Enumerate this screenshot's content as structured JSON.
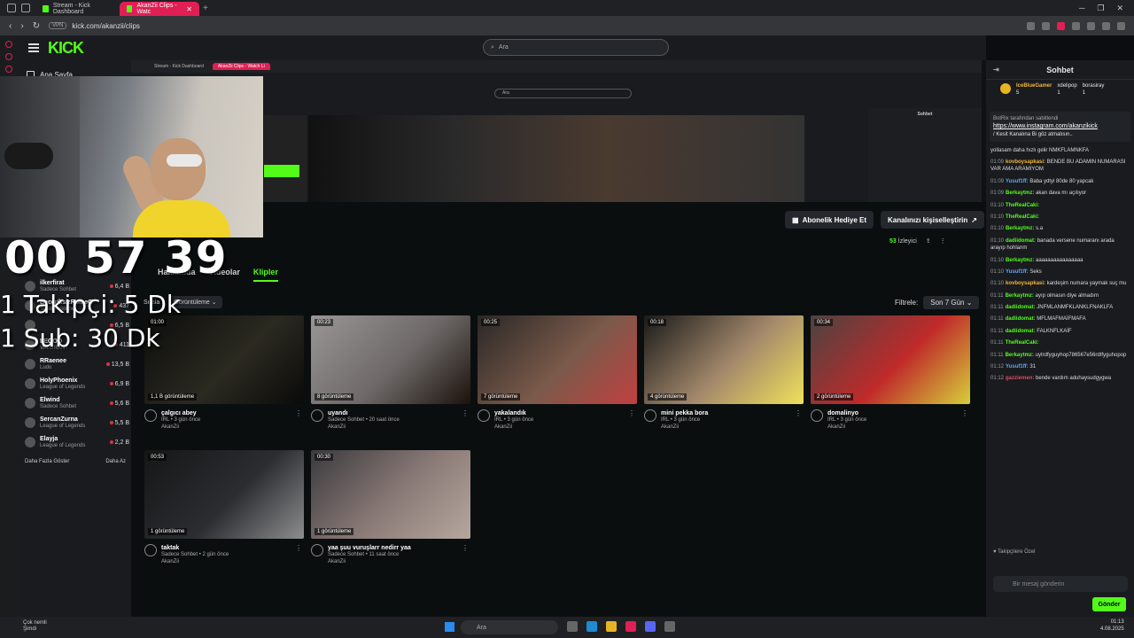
{
  "browser": {
    "tabs": [
      {
        "label": "Stream - Kick Dashboard"
      },
      {
        "label": "AkanZii Clips - Watc"
      }
    ],
    "url": "kick.com/akanzii/clips",
    "vpn_label": "VPN"
  },
  "header": {
    "logo": "KICK",
    "search_placeholder": "Ara"
  },
  "left_nav": {
    "home_label": "Ana Sayfa",
    "streamers": [
      {
        "name": "ilkerfirat",
        "category": "Sadece Sohbet",
        "count": "6,4 B"
      },
      {
        "name": "BeceriksizRomeO",
        "category": "Sadece Sohbet",
        "count": "437"
      },
      {
        "name": "",
        "category": "",
        "count": "6,5 B"
      },
      {
        "name": "LEGOO",
        "category": "VALORANT",
        "count": "411"
      },
      {
        "name": "RRaenee",
        "category": "Ludo",
        "count": "13,5 B"
      },
      {
        "name": "HolyPhoenix",
        "category": "League of Legends",
        "count": "6,9 B"
      },
      {
        "name": "Elwind",
        "category": "Sadece Sohbet",
        "count": "5,6 B"
      },
      {
        "name": "SercanZurna",
        "category": "League of Legends",
        "count": "5,5 B"
      },
      {
        "name": "Elayja",
        "category": "League of Legends",
        "count": "2,2 B"
      }
    ],
    "show_more": "Daha Fazla Göster",
    "show_less": "Daha Az"
  },
  "overlay": {
    "timer": "00 57 39",
    "goal_follow": "1 Takipçi: 5 Dk",
    "goal_sub": "1 Sub: 30 Dk"
  },
  "nested": {
    "tab1": "Stream - Kick Dashboard",
    "tab2": "AkanZii Clips - Watch Li",
    "search": "Ara",
    "chat_title": "Sohbet"
  },
  "channel": {
    "gift_sub": "Abonelik Hediye Et",
    "customize": "Kanalınızı kişiselleştirin",
    "viewers_num": "53",
    "viewers_label": "İzleyici",
    "tabs": [
      "Hakkımda",
      "Videolar",
      "Klipler"
    ],
    "sort_label": "Sırala",
    "sort_value": "Görüntüleme",
    "filter_label": "Filtrele:",
    "filter_value": "Son 7 Gün"
  },
  "clips": [
    {
      "duration": "01:00",
      "views": "1,1 B görüntüleme",
      "title": "çalgıcı abey",
      "sub": "IRL • 3 gün önce",
      "channel": "AkanZii",
      "colors": [
        "#0c0c0c",
        "#2b2a20",
        "#0a0a0a"
      ]
    },
    {
      "duration": "00:23",
      "views": "8 görüntüleme",
      "title": "uyandı",
      "sub": "Sadece Sohbet • 20 saat önce",
      "channel": "AkanZii",
      "colors": [
        "#9a9696",
        "#6d6867",
        "#1b120c"
      ]
    },
    {
      "duration": "00:25",
      "views": "7 görüntüleme",
      "title": "yakalandık",
      "sub": "IRL • 3 gün önce",
      "channel": "AkanZii",
      "colors": [
        "#2a2727",
        "#7a5a4a",
        "#c14040"
      ]
    },
    {
      "duration": "00:18",
      "views": "4 görüntüleme",
      "title": "mini pekka bora",
      "sub": "IRL • 3 gün önce",
      "channel": "AkanZii",
      "colors": [
        "#1a1a1a",
        "#a58a6c",
        "#efe05a"
      ]
    },
    {
      "duration": "00:34",
      "views": "2 görüntüleme",
      "title": "domalinyo",
      "sub": "IRL • 3 gün önce",
      "channel": "AkanZii",
      "colors": [
        "#4a4442",
        "#bf2a2a",
        "#d6cf3a"
      ]
    },
    {
      "duration": "00:53",
      "views": "1 görüntüleme",
      "title": "taktak",
      "sub": "Sadece Sohbet • 2 gün önce",
      "channel": "AkanZii",
      "colors": [
        "#161616",
        "#2b2d31",
        "#8d8d8d"
      ]
    },
    {
      "duration": "00:30",
      "views": "1 görüntüleme",
      "title": "yaa şuu vuruşlarr nedirr yaa",
      "sub": "Sadece Sohbet • 11 saat önce",
      "channel": "AkanZii",
      "colors": [
        "#3b3a3e",
        "#8c7c78",
        "#b5a79e"
      ]
    }
  ],
  "chat": {
    "title": "Sohbet",
    "gifters": [
      {
        "name": "IceBlueGamer",
        "count": "5"
      },
      {
        "name": "xdelipop",
        "count": "1"
      },
      {
        "name": "borasiray",
        "count": "1"
      }
    ],
    "pinned_by": "BotRix tarafından sabitlendi",
    "pinned_link": "https://www.instagram.com/akanzikick",
    "pinned_text": "/ Kesit Kanalına Bi göz atmalısın..",
    "messages": [
      {
        "time": "",
        "user": "",
        "color": "#ddd",
        "text": "yollasam daha hızlı gelir NMKFLAMNKFA"
      },
      {
        "time": "01:09",
        "user": "kovboysapkasi:",
        "color": "#f2b63a",
        "text": "BENDE BU ADAMIN NUMARASI VAR AMA ARAMIYOM"
      },
      {
        "time": "01:09",
        "user": "Yusuf1ff:",
        "color": "#5aa9ff",
        "text": "Baba ydtyl 80de 80 yapcak"
      },
      {
        "time": "01:09",
        "user": "Berkaytmz:",
        "color": "#53fc18",
        "text": "akan dava mı açılıyor"
      },
      {
        "time": "01:10",
        "user": "TheRealCaki:",
        "color": "#53fc18",
        "text": ""
      },
      {
        "time": "01:10",
        "user": "TheRealCaki:",
        "color": "#53fc18",
        "text": ""
      },
      {
        "time": "01:10",
        "user": "Berkaytmz:",
        "color": "#53fc18",
        "text": "s.a"
      },
      {
        "time": "01:10",
        "user": "dadiidomat:",
        "color": "#53fc18",
        "text": "banada versene numaranı arada arayıp hohlanm"
      },
      {
        "time": "01:10",
        "user": "Berkaytmz:",
        "color": "#53fc18",
        "text": "aaaaaaaaaaaaaaaa"
      },
      {
        "time": "01:10",
        "user": "Yusuf1ff:",
        "color": "#5aa9ff",
        "text": "Seks"
      },
      {
        "time": "01:10",
        "user": "kovboysapkasi:",
        "color": "#f2b63a",
        "text": "kardeşim numara yaymak suç mu"
      },
      {
        "time": "01:11",
        "user": "Berkaytmz:",
        "color": "#53fc18",
        "text": "ayıp olmasın diye almadım"
      },
      {
        "time": "01:11",
        "user": "dadiidomat:",
        "color": "#53fc18",
        "text": "JNFMLANMFKLANKLFNAKLFA"
      },
      {
        "time": "01:11",
        "user": "dadiidomat:",
        "color": "#53fc18",
        "text": "MFLMAFMAİFMAFA"
      },
      {
        "time": "01:11",
        "user": "dadiidomat:",
        "color": "#53fc18",
        "text": "FALKNFLKAİF"
      },
      {
        "time": "01:11",
        "user": "TheRealCaki:",
        "color": "#53fc18",
        "text": ""
      },
      {
        "time": "01:11",
        "user": "Berkaytmz:",
        "color": "#53fc18",
        "text": "uytrdfyguyhop786567e56rdtfyguhopop"
      },
      {
        "time": "01:12",
        "user": "Yusuf1ff:",
        "color": "#5aa9ff",
        "text": "31"
      },
      {
        "time": "01:12",
        "user": "gazziemen:",
        "color": "#e04a5a",
        "text": "bende vardım aduhaysudgygwa"
      }
    ],
    "emote_label": "Takipçilere Özel",
    "input_placeholder": "Bir mesaj gönderin",
    "send": "Gönder"
  },
  "taskbar": {
    "weather1": "Çok nemli",
    "weather2": "Şimdi",
    "search": "Ara",
    "time": "01:13",
    "date": "4.08.2025"
  }
}
